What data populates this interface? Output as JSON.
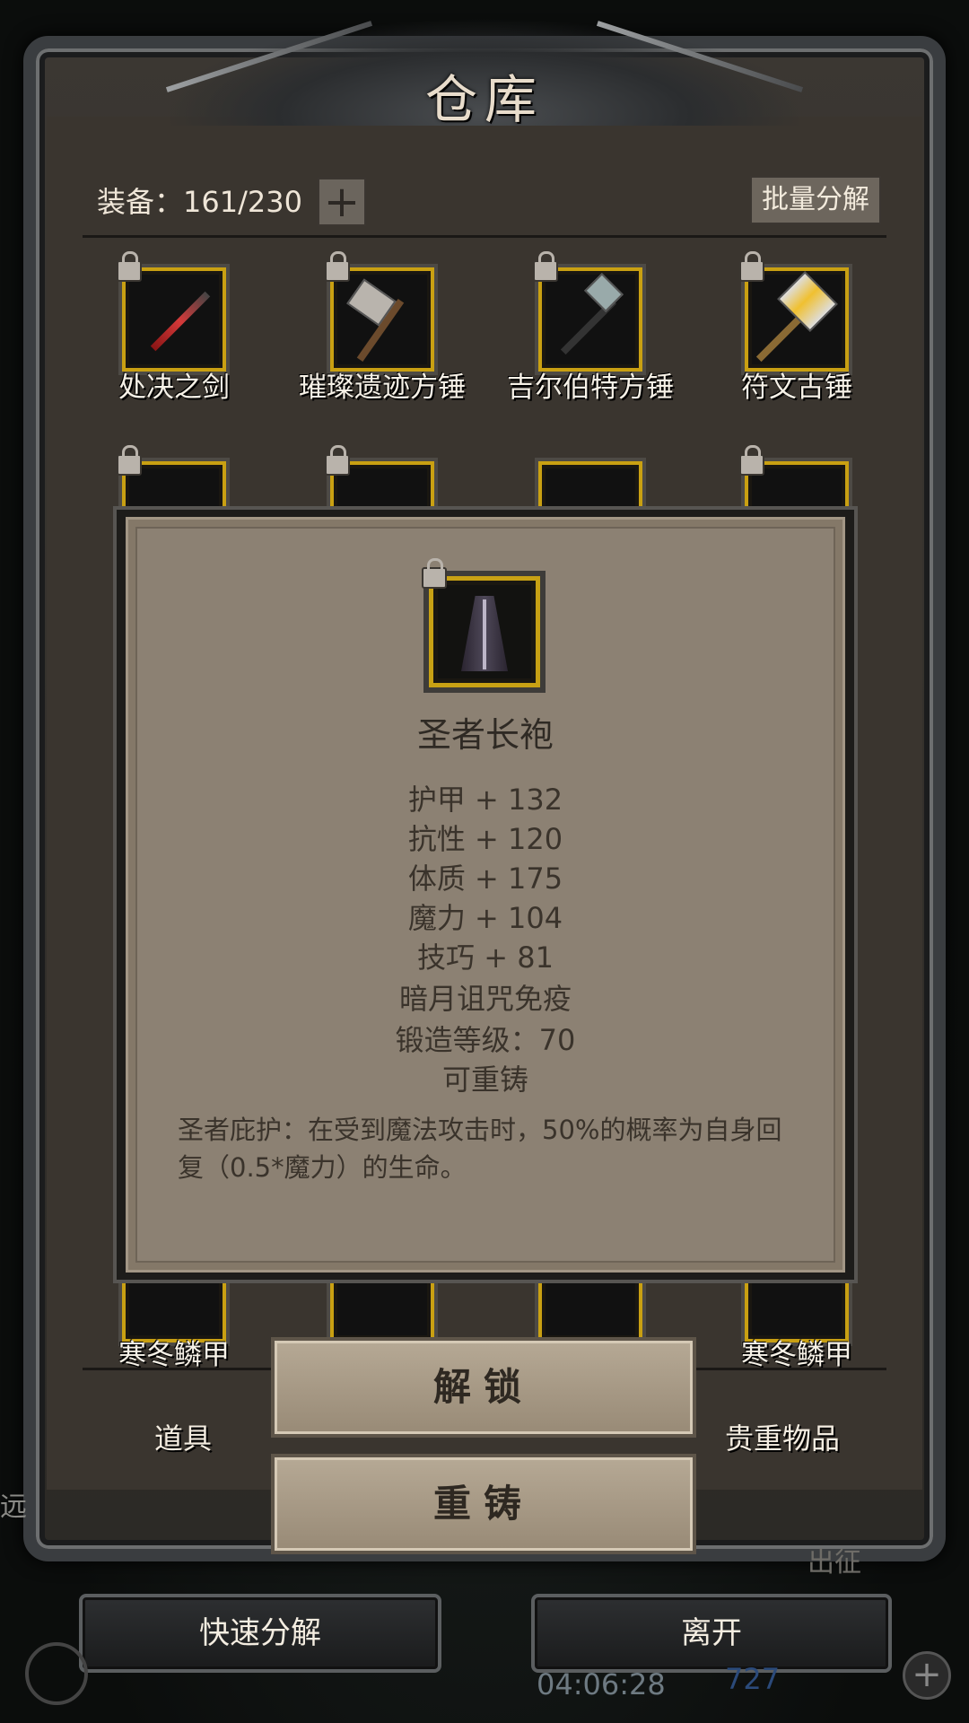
{
  "window": {
    "title": "仓库"
  },
  "header": {
    "equip_label": "装备：161/230",
    "add_button": "+",
    "batch_button": "批量分解"
  },
  "grid_items": [
    {
      "name": "处决之剑",
      "icon": "sword-icon",
      "locked": true
    },
    {
      "name": "璀璨遗迹方锤",
      "icon": "hammer-icon",
      "locked": true
    },
    {
      "name": "吉尔伯特方锤",
      "icon": "hammer-icon",
      "locked": true
    },
    {
      "name": "符文古锤",
      "icon": "hammer-icon",
      "locked": true
    }
  ],
  "bottom_row_items": [
    {
      "name": "寒冬鳞甲"
    },
    {
      "name": "寒冬鳞甲"
    }
  ],
  "tabs": {
    "left": "道具",
    "right": "贵重物品"
  },
  "footer": {
    "quick_decompose": "快速分解",
    "leave": "离开",
    "timer": "04:06:28",
    "side_text": "出征",
    "left_fragment": "远",
    "count_fragment": "727"
  },
  "popup": {
    "item_name": "圣者长袍",
    "icon": "robe-icon",
    "stats": [
      "护甲 + 132",
      "抗性 + 120",
      "体质 + 175",
      "魔力 + 104",
      "技巧 + 81",
      "暗月诅咒免疫",
      "锻造等级：70",
      "可重铸"
    ],
    "description": "圣者庇护：在受到魔法攻击时，50%的概率为自身回复（0.5*魔力）的生命。",
    "unlock_button": "解锁",
    "reforge_button": "重铸"
  },
  "colors": {
    "gold_border": "#c9a012",
    "panel": "#8c8173",
    "frame": "#3a352f"
  }
}
